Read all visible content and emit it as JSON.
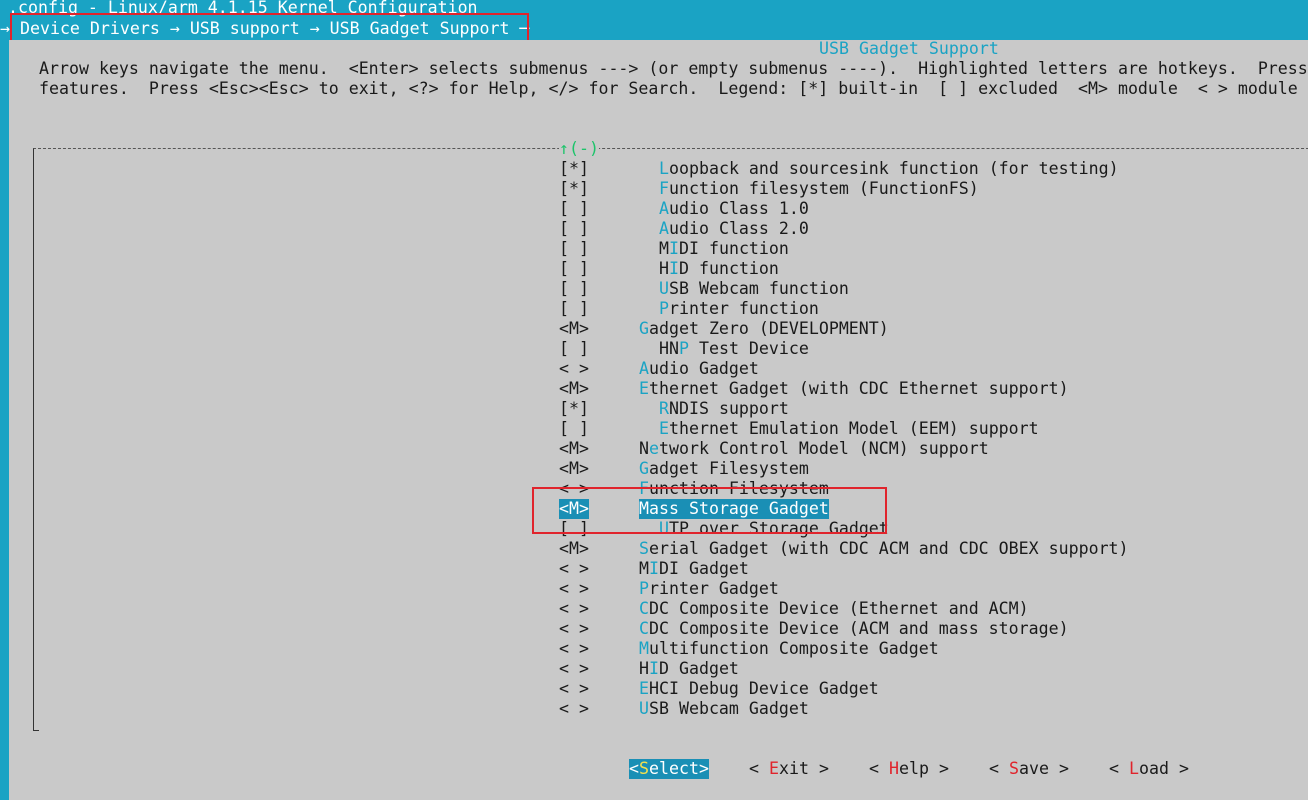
{
  "window": {
    "title": ".config - Linux/arm 4.1.15 Kernel Configuration",
    "breadcrumb": "→ Device Drivers → USB support → USB Gadget Support ─"
  },
  "dialog": {
    "title": "USB Gadget Support",
    "help_line1": "Arrow keys navigate the menu.  <Enter> selects submenus ---> (or empty submenus ----).  Highlighted letters are hotkeys.  Press",
    "help_line2": "features.  Press <Esc><Esc> to exit, <?> for Help, </> for Search.  Legend: [*] built-in  [ ] excluded  <M> module  < > module",
    "scroll_indicator": "↑(-)"
  },
  "menu": {
    "items": [
      {
        "state": "[*]",
        "pre": "",
        "hotkey": "L",
        "rest": "oopback and sourcesink function (for testing)",
        "indent": 2
      },
      {
        "state": "[*]",
        "pre": "",
        "hotkey": "F",
        "rest": "unction filesystem (FunctionFS)",
        "indent": 2
      },
      {
        "state": "[ ]",
        "pre": "",
        "hotkey": "A",
        "rest": "udio Class 1.0",
        "indent": 2
      },
      {
        "state": "[ ]",
        "pre": "",
        "hotkey": "A",
        "rest": "udio Class 2.0",
        "indent": 2
      },
      {
        "state": "[ ]",
        "pre": "M",
        "hotkey": "I",
        "rest": "DI function",
        "indent": 2
      },
      {
        "state": "[ ]",
        "pre": "H",
        "hotkey": "I",
        "rest": "D function",
        "indent": 2
      },
      {
        "state": "[ ]",
        "pre": "",
        "hotkey": "U",
        "rest": "SB Webcam function",
        "indent": 2
      },
      {
        "state": "[ ]",
        "pre": "",
        "hotkey": "P",
        "rest": "rinter function",
        "indent": 2
      },
      {
        "state": "<M>",
        "pre": "",
        "hotkey": "G",
        "rest": "adget Zero (DEVELOPMENT)",
        "indent": 1
      },
      {
        "state": "[ ]",
        "pre": "HN",
        "hotkey": "P",
        "rest": " Test Device",
        "indent": 2
      },
      {
        "state": "< >",
        "pre": "",
        "hotkey": "A",
        "rest": "udio Gadget",
        "indent": 1
      },
      {
        "state": "<M>",
        "pre": "",
        "hotkey": "E",
        "rest": "thernet Gadget (with CDC Ethernet support)",
        "indent": 1
      },
      {
        "state": "[*]",
        "pre": "",
        "hotkey": "R",
        "rest": "NDIS support",
        "indent": 2
      },
      {
        "state": "[ ]",
        "pre": "",
        "hotkey": "E",
        "rest": "thernet Emulation Model (EEM) support",
        "indent": 2
      },
      {
        "state": "<M>",
        "pre": "N",
        "hotkey": "e",
        "rest": "twork Control Model (NCM) support",
        "indent": 1
      },
      {
        "state": "<M>",
        "pre": "",
        "hotkey": "G",
        "rest": "adget Filesystem",
        "indent": 1
      },
      {
        "state": "< >",
        "pre": "",
        "hotkey": "F",
        "rest": "unction Filesystem",
        "indent": 1
      },
      {
        "state": "<M>",
        "pre": "M",
        "hotkey": "a",
        "rest": "ss Storage Gadget",
        "indent": 1,
        "selected": true
      },
      {
        "state": "[ ]",
        "pre": "",
        "hotkey": "U",
        "rest": "TP over Storage Gadget",
        "indent": 2
      },
      {
        "state": "<M>",
        "pre": "",
        "hotkey": "S",
        "rest": "erial Gadget (with CDC ACM and CDC OBEX support)",
        "indent": 1
      },
      {
        "state": "< >",
        "pre": "M",
        "hotkey": "I",
        "rest": "DI Gadget",
        "indent": 1
      },
      {
        "state": "< >",
        "pre": "",
        "hotkey": "P",
        "rest": "rinter Gadget",
        "indent": 1
      },
      {
        "state": "< >",
        "pre": "",
        "hotkey": "C",
        "rest": "DC Composite Device (Ethernet and ACM)",
        "indent": 1
      },
      {
        "state": "< >",
        "pre": "",
        "hotkey": "C",
        "rest": "DC Composite Device (ACM and mass storage)",
        "indent": 1
      },
      {
        "state": "< >",
        "pre": "",
        "hotkey": "M",
        "rest": "ultifunction Composite Gadget",
        "indent": 1
      },
      {
        "state": "< >",
        "pre": "H",
        "hotkey": "I",
        "rest": "D Gadget",
        "indent": 1
      },
      {
        "state": "< >",
        "pre": "",
        "hotkey": "E",
        "rest": "HCI Debug Device Gadget",
        "indent": 1
      },
      {
        "state": "< >",
        "pre": "",
        "hotkey": "U",
        "rest": "SB Webcam Gadget",
        "indent": 1
      }
    ]
  },
  "buttons": [
    {
      "open": "<",
      "hotkey": "S",
      "rest": "elect",
      "close": ">",
      "active": true
    },
    {
      "open": "< ",
      "hotkey": "E",
      "rest": "xit",
      "close": " >",
      "active": false
    },
    {
      "open": "< ",
      "hotkey": "H",
      "rest": "elp",
      "close": " >",
      "active": false
    },
    {
      "open": "< ",
      "hotkey": "S",
      "rest": "ave",
      "close": " >",
      "active": false
    },
    {
      "open": "< ",
      "hotkey": "L",
      "rest": "oad",
      "close": " >",
      "active": false
    }
  ],
  "colors": {
    "background": "#1aa3c4",
    "dialog": "#c9c9c9",
    "hotkey": "#1aa3c4",
    "selection": "#1a8fb5",
    "annotation_box": "#e0242c"
  }
}
